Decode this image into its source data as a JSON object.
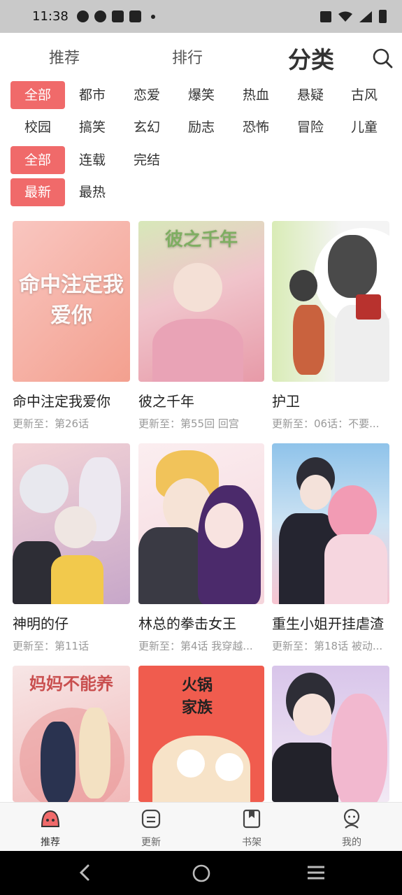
{
  "status": {
    "time": "11:38"
  },
  "topnav": {
    "tabs": [
      "推荐",
      "排行",
      "分类"
    ],
    "active_index": 2
  },
  "filters": {
    "genre_row1": [
      "全部",
      "都市",
      "恋爱",
      "爆笑",
      "热血",
      "悬疑",
      "古风"
    ],
    "genre_row2": [
      "校园",
      "搞笑",
      "玄幻",
      "励志",
      "恐怖",
      "冒险",
      "儿童"
    ],
    "status_row": [
      "全部",
      "连载",
      "完结"
    ],
    "sort_row": [
      "最新",
      "最热"
    ],
    "active_genre": "全部",
    "active_status": "全部",
    "active_sort": "最新"
  },
  "comics": [
    {
      "title": "命中注定我爱你",
      "update": "更新至：第26话",
      "cover_text": "命中注定我爱你",
      "colors": [
        "#f9c6c0",
        "#f3a08f"
      ]
    },
    {
      "title": "彼之千年",
      "update": "更新至：第55回 回宫",
      "cover_text": "彼之千年",
      "colors": [
        "#d7e8b9",
        "#e79aa8"
      ]
    },
    {
      "title": "护卫",
      "update": "更新至：06话：不要...",
      "cover_text": "",
      "colors": [
        "#d9ecb6",
        "#f4f4f4"
      ]
    },
    {
      "title": "神明的仔",
      "update": "更新至：第11话",
      "cover_text": "",
      "colors": [
        "#f3d3d6",
        "#c7a7c9"
      ]
    },
    {
      "title": "林总的拳击女王",
      "update": "更新至：第4话 我穿越...",
      "cover_text": "",
      "colors": [
        "#fbeef0",
        "#6a3f83"
      ]
    },
    {
      "title": "重生小姐开挂虐渣",
      "update": "更新至：第18话 被动...",
      "cover_text": "",
      "colors": [
        "#8fc3ea",
        "#f7c4d0"
      ]
    },
    {
      "title": "",
      "update": "",
      "cover_text": "妈妈不能养",
      "colors": [
        "#f7d8d8",
        "#e88e8e"
      ]
    },
    {
      "title": "",
      "update": "",
      "cover_text": "火锅家族",
      "colors": [
        "#f05c4e",
        "#f7e3c8"
      ]
    },
    {
      "title": "",
      "update": "",
      "cover_text": "",
      "colors": [
        "#d8c5ea",
        "#f2b8cf"
      ]
    }
  ],
  "tabbar": {
    "items": [
      "推荐",
      "更新",
      "书架",
      "我的"
    ],
    "active_index": 0
  },
  "colors": {
    "accent": "#f06a6a",
    "statusbar": "#c9c9c9"
  }
}
